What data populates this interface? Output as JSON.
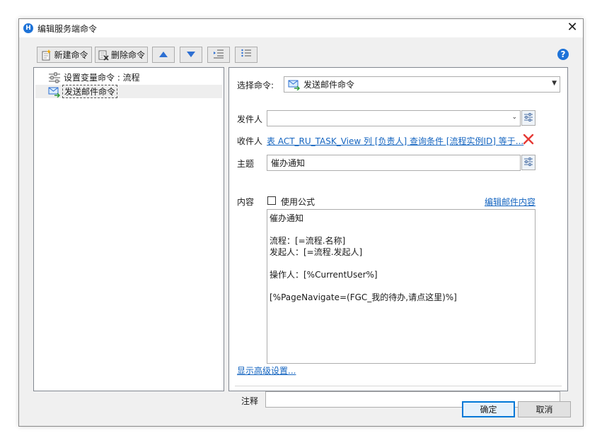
{
  "window": {
    "title": "编辑服务端命令"
  },
  "toolbar": {
    "new_label": "新建命令",
    "delete_label": "删除命令"
  },
  "tree": {
    "items": [
      {
        "label": "设置变量命令 : 流程",
        "icon": "sliders-icon",
        "selected": false
      },
      {
        "label": "发送邮件命令",
        "icon": "mail-send-icon",
        "selected": true
      }
    ]
  },
  "form": {
    "select_command_label": "选择命令:",
    "select_command_value": "发送邮件命令",
    "sender_label": "发件人",
    "sender_value": "",
    "recipient_label": "收件人",
    "recipient_link": "表 ACT_RU_TASK_View 列 [负责人] 查询条件 [流程实例ID] 等于...",
    "subject_label": "主题",
    "subject_value": "催办通知",
    "content_label": "内容",
    "use_formula_label": "使用公式",
    "use_formula_checked": false,
    "edit_mail_link": "编辑邮件内容",
    "content_text": "催办通知\n\n流程：[=流程.名称]\n发起人：[=流程.发起人]\n\n操作人：[%CurrentUser%]\n\n[%PageNavigate=(FGC_我的待办,请点这里)%]",
    "advanced_link": "显示高级设置...",
    "note_label": "注释",
    "note_value": ""
  },
  "buttons": {
    "ok_label": "确定",
    "cancel_label": "取消"
  },
  "colors": {
    "accent": "#1e73d8",
    "link": "#1565c0",
    "remove": "#e53935"
  }
}
